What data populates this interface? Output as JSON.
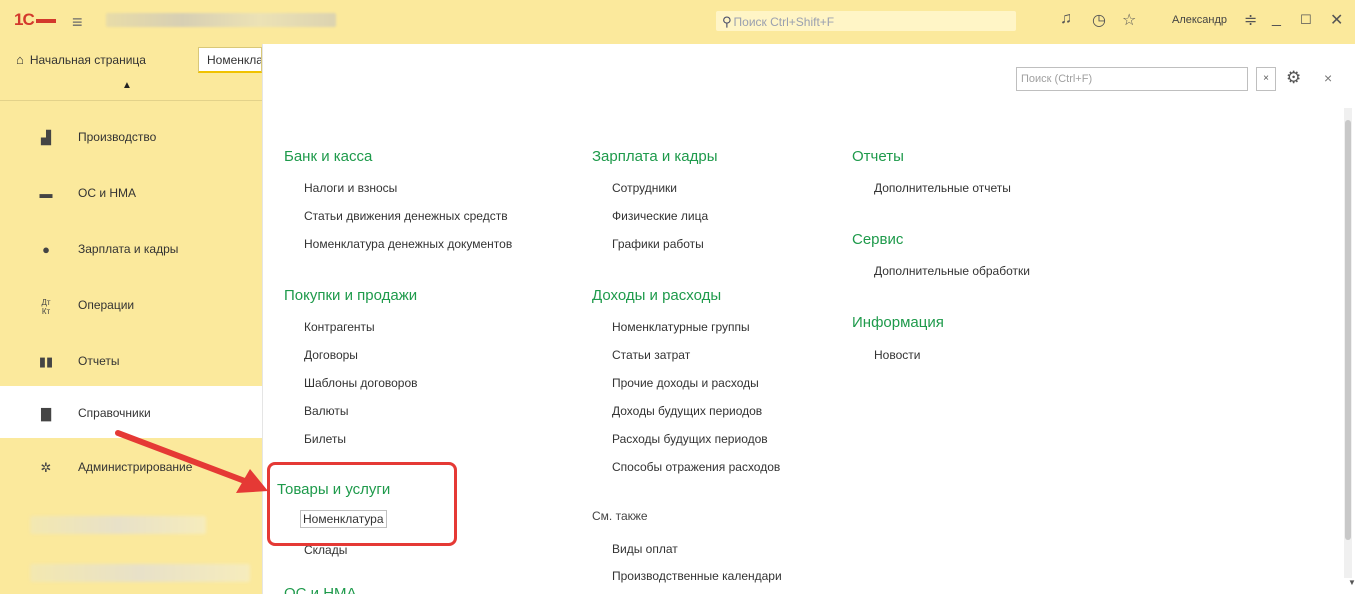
{
  "topbar": {
    "logo": "1С",
    "search_placeholder": "Поиск Ctrl+Shift+F",
    "user_name": "Александр",
    "icons": [
      "bell-icon",
      "history-icon",
      "star-icon",
      "settings-menu-icon",
      "minimize-icon",
      "maximize-icon",
      "close-icon"
    ]
  },
  "tabs": {
    "home_label": "Начальная страница",
    "current_label": "Номенклатура"
  },
  "sidebar": {
    "items": [
      {
        "label": "Производство",
        "icon": "factory-icon"
      },
      {
        "label": "ОС и НМА",
        "icon": "truck-icon"
      },
      {
        "label": "Зарплата и кадры",
        "icon": "person-icon"
      },
      {
        "label": "Операции",
        "icon": "dt-kt-icon"
      },
      {
        "label": "Отчеты",
        "icon": "bar-chart-icon"
      },
      {
        "label": "Справочники",
        "icon": "book-icon",
        "active": true
      },
      {
        "label": "Администрирование",
        "icon": "gear-icon"
      }
    ]
  },
  "panel": {
    "search_placeholder": "Поиск (Ctrl+F)",
    "clear_label": "×",
    "close_label": "×",
    "col1": {
      "sections": [
        {
          "title": "Банк и касса",
          "links": [
            "Налоги и взносы",
            "Статьи движения денежных средств",
            "Номенклатура денежных документов"
          ]
        },
        {
          "title": "Покупки и продажи",
          "links": [
            "Контрагенты",
            "Договоры",
            "Шаблоны договоров",
            "Валюты",
            "Билеты"
          ]
        },
        {
          "title": "Товары и услуги",
          "links": [
            "Номенклатура",
            "Склады"
          ]
        },
        {
          "title": "ОС и НМА",
          "links": []
        }
      ]
    },
    "col2": {
      "sections": [
        {
          "title": "Зарплата и кадры",
          "links": [
            "Сотрудники",
            "Физические лица",
            "Графики работы"
          ]
        },
        {
          "title": "Доходы и расходы",
          "links": [
            "Номенклатурные группы",
            "Статьи затрат",
            "Прочие доходы и расходы",
            "Доходы будущих периодов",
            "Расходы будущих периодов",
            "Способы отражения расходов"
          ]
        }
      ],
      "see_also_label": "См. также",
      "see_also_links": [
        "Виды оплат",
        "Производственные календари"
      ]
    },
    "col3": {
      "sections": [
        {
          "title": "Отчеты",
          "links": [
            "Дополнительные отчеты"
          ]
        },
        {
          "title": "Сервис",
          "links": [
            "Дополнительные обработки"
          ]
        },
        {
          "title": "Информация",
          "links": [
            "Новости"
          ]
        }
      ]
    }
  },
  "colors": {
    "topbar_bg": "#fbe99c",
    "section_title": "#1e9a4b",
    "highlight": "#e53935"
  }
}
